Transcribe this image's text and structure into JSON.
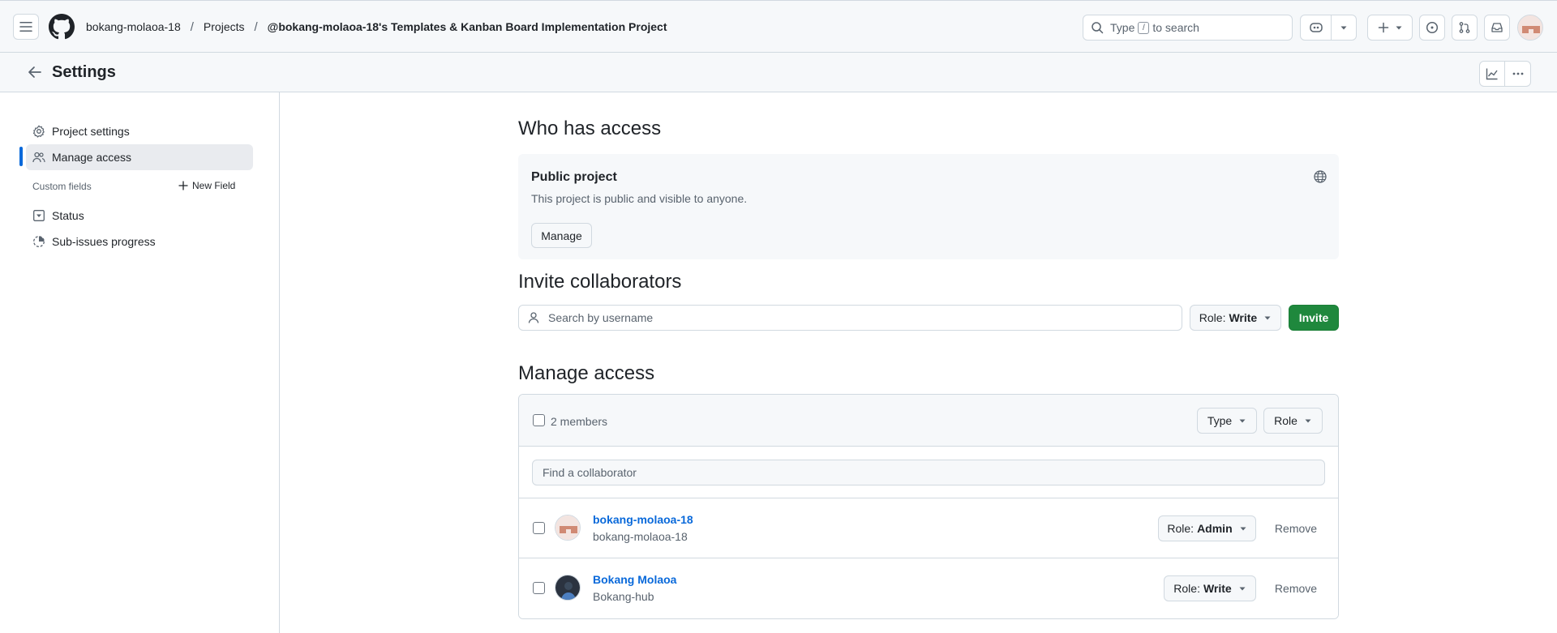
{
  "header": {
    "breadcrumbs": [
      "bokang-molaoa-18",
      "Projects",
      "@bokang-molaoa-18's Templates & Kanban Board Implementation Project"
    ],
    "separator": "/",
    "search": {
      "before": "Type",
      "key": "/",
      "after": "to search"
    },
    "icons": [
      "hamburger-icon",
      "github-logo",
      "search-icon",
      "copilot-icon",
      "plus-icon",
      "issues-icon",
      "pull-requests-icon",
      "inbox-icon"
    ]
  },
  "settings_header": {
    "title": "Settings"
  },
  "sidebar": {
    "items": [
      {
        "label": "Project settings",
        "icon": "gear-icon"
      },
      {
        "label": "Manage access",
        "icon": "people-icon",
        "active": true
      }
    ],
    "custom_fields_label": "Custom fields",
    "new_field_label": "New Field",
    "fields": [
      {
        "label": "Status",
        "icon": "single-select-icon"
      },
      {
        "label": "Sub-issues progress",
        "icon": "progress-icon"
      }
    ]
  },
  "who_has_access": {
    "heading": "Who has access",
    "visibility_title": "Public project",
    "visibility_desc": "This project is public and visible to anyone.",
    "manage_label": "Manage"
  },
  "invite": {
    "heading": "Invite collaborators",
    "placeholder": "Search by username",
    "role_prefix": "Role:",
    "role_value": "Write",
    "invite_label": "Invite"
  },
  "manage_access": {
    "heading": "Manage access",
    "members_count_label": "2 members",
    "type_filter": "Type",
    "role_filter": "Role",
    "find_placeholder": "Find a collaborator",
    "members": [
      {
        "name": "bokang-molaoa-18",
        "login": "bokang-molaoa-18",
        "role_prefix": "Role:",
        "role": "Admin",
        "remove_label": "Remove"
      },
      {
        "name": "Bokang Molaoa",
        "login": "Bokang-hub",
        "role_prefix": "Role:",
        "role": "Write",
        "remove_label": "Remove"
      }
    ]
  },
  "colors": {
    "accent": "#0969da",
    "invite_green": "#1f883d",
    "border": "#d1d9e0",
    "muted_text": "#59636e"
  }
}
